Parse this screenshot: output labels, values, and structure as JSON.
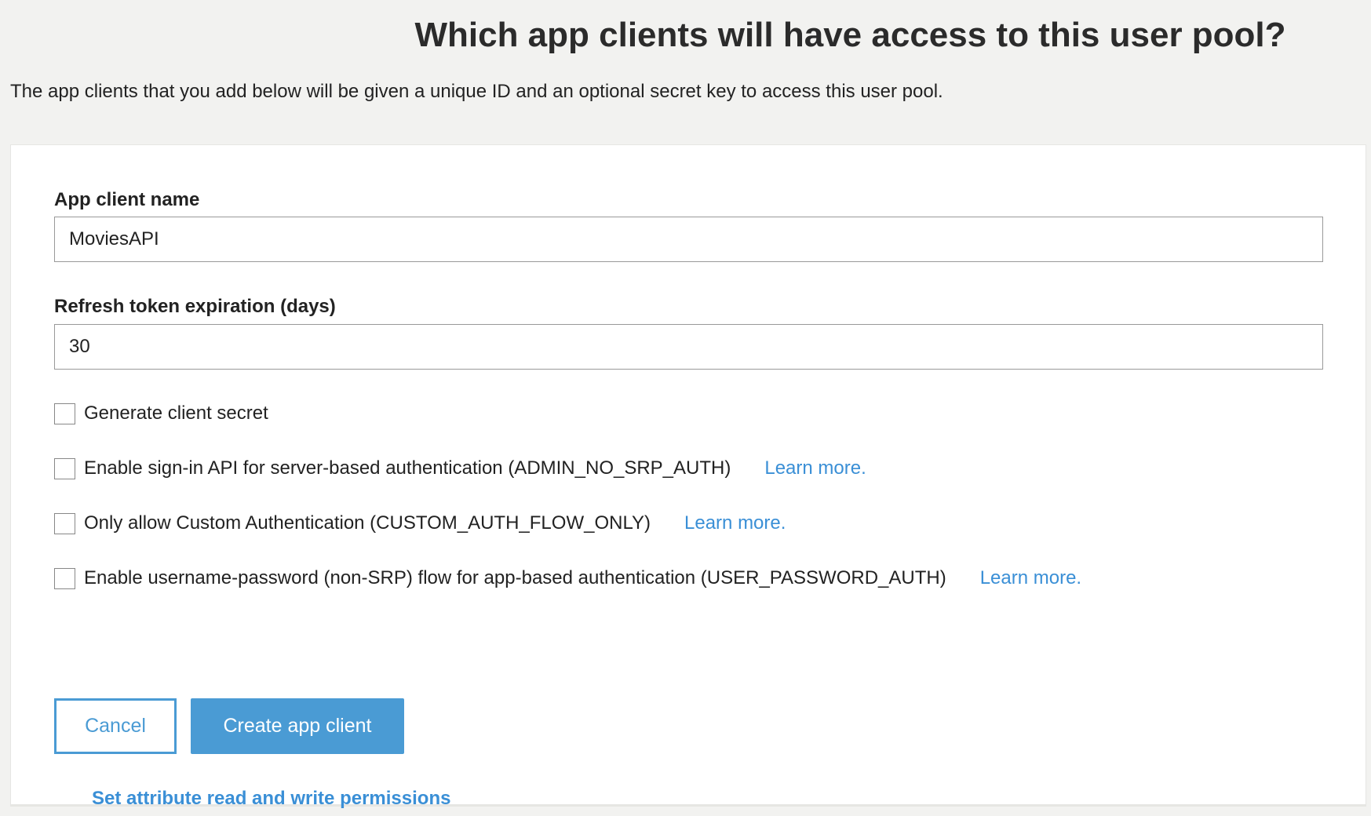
{
  "header": {
    "title": "Which app clients will have access to this user pool?",
    "subtitle": "The app clients that you add below will be given a unique ID and an optional secret key to access this user pool."
  },
  "form": {
    "app_client_name": {
      "label": "App client name",
      "value": "MoviesAPI"
    },
    "refresh_token": {
      "label": "Refresh token expiration (days)",
      "value": "30"
    },
    "checkboxes": [
      {
        "label": "Generate client secret",
        "checked": false
      },
      {
        "label": "Enable sign-in API for server-based authentication (ADMIN_NO_SRP_AUTH)",
        "checked": false,
        "link": "Learn more."
      },
      {
        "label": "Only allow Custom Authentication (CUSTOM_AUTH_FLOW_ONLY)",
        "checked": false,
        "link": "Learn more."
      },
      {
        "label": "Enable username-password (non-SRP) flow for app-based authentication (USER_PASSWORD_AUTH)",
        "checked": false,
        "link": "Learn more."
      }
    ],
    "permissions_link": "Set attribute read and write permissions",
    "cancel_label": "Cancel",
    "create_label": "Create app client"
  },
  "colors": {
    "accent": "#4a9bd4",
    "link": "#3a8fd6"
  }
}
